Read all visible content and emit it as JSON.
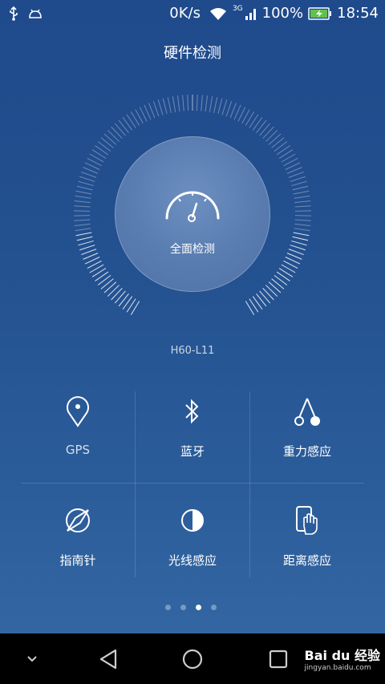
{
  "status_bar": {
    "net_speed": "0K/s",
    "signal_label": "3G",
    "battery": "100%",
    "time": "18:54"
  },
  "header": {
    "title": "硬件检测"
  },
  "main": {
    "scan_button_label": "全面检测",
    "device_model": "H60-L11"
  },
  "tests": [
    {
      "label": "GPS",
      "icon": "location-pin-icon"
    },
    {
      "label": "蓝牙",
      "icon": "bluetooth-icon"
    },
    {
      "label": "重力感应",
      "icon": "gravity-icon"
    },
    {
      "label": "指南针",
      "icon": "compass-icon"
    },
    {
      "label": "光线感应",
      "icon": "light-sensor-icon"
    },
    {
      "label": "距离感应",
      "icon": "proximity-icon"
    }
  ],
  "pager": {
    "count": 4,
    "active_index": 2
  },
  "watermark": {
    "brand": "Bai du 经验",
    "url": "jingyan.baidu.com"
  }
}
